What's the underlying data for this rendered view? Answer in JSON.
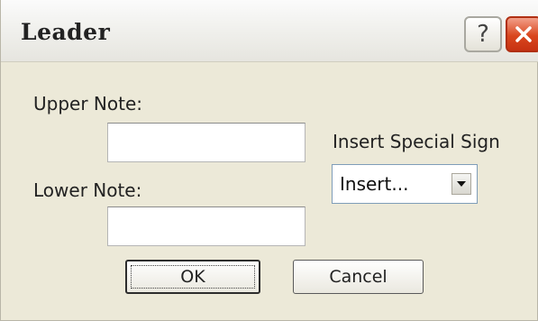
{
  "window": {
    "title": "Leader"
  },
  "titlebar": {
    "help_icon": "question-mark-icon",
    "help_glyph": "?",
    "close_icon": "close-x-icon"
  },
  "form": {
    "upper_note_label": "Upper Note:",
    "upper_note_value": "",
    "lower_note_label": "Lower Note:",
    "lower_note_value": "",
    "special_sign_label": "Insert Special Sign",
    "special_sign_selected": "Insert..."
  },
  "buttons": {
    "ok_label": "OK",
    "cancel_label": "Cancel"
  },
  "colors": {
    "dialog_background": "#ece9d8",
    "close_button": "#d9461e"
  }
}
